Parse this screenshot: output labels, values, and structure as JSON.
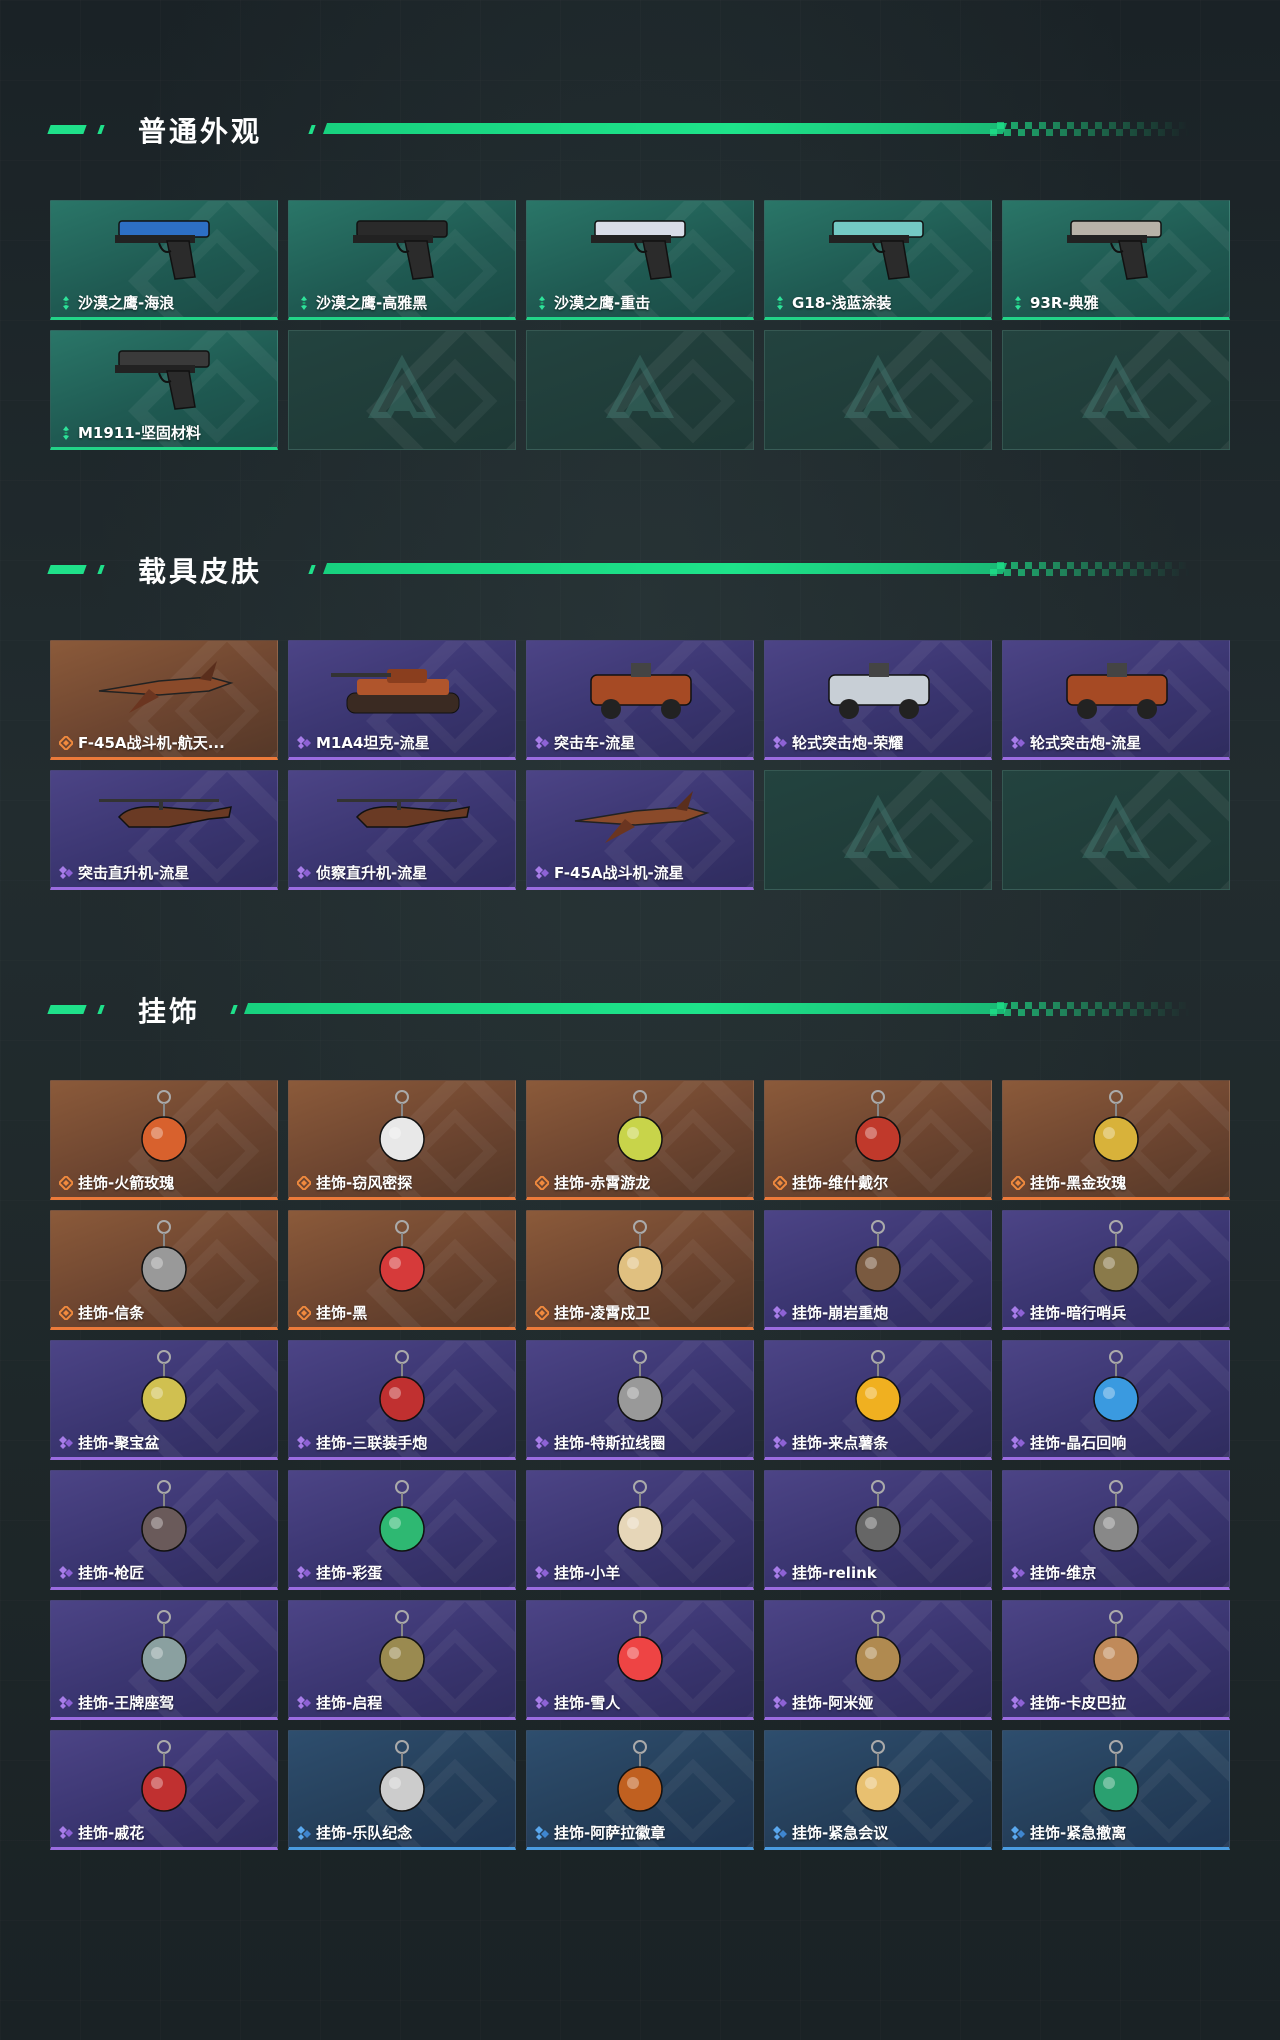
{
  "colors": {
    "accent": "#1ee38a",
    "green_card": "#1f5a52",
    "purple_card": "#3a3570",
    "orange_card": "#6d4530",
    "blue_card": "#253f5a"
  },
  "sections": [
    {
      "title": "普通外观",
      "items": [
        {
          "label": "沙漠之鹰-海浪",
          "rarity": "green",
          "icon": "pistol-icon"
        },
        {
          "label": "沙漠之鹰-高雅黑",
          "rarity": "green",
          "icon": "pistol-icon"
        },
        {
          "label": "沙漠之鹰-重击",
          "rarity": "green",
          "icon": "pistol-icon"
        },
        {
          "label": "G18-浅蓝涂装",
          "rarity": "green",
          "icon": "pistol-icon"
        },
        {
          "label": "93R-典雅",
          "rarity": "green",
          "icon": "pistol-icon"
        },
        {
          "label": "M1911-坚固材料",
          "rarity": "green",
          "icon": "pistol-icon"
        },
        {
          "label": "",
          "rarity": "empty",
          "icon": "empty-slot-logo-icon"
        },
        {
          "label": "",
          "rarity": "empty",
          "icon": "empty-slot-logo-icon"
        },
        {
          "label": "",
          "rarity": "empty",
          "icon": "empty-slot-logo-icon"
        },
        {
          "label": "",
          "rarity": "empty",
          "icon": "empty-slot-logo-icon"
        }
      ]
    },
    {
      "title": "载具皮肤",
      "items": [
        {
          "label": "F-45A战斗机-航天...",
          "rarity": "orange",
          "icon": "jet-icon"
        },
        {
          "label": "M1A4坦克-流星",
          "rarity": "purple",
          "icon": "tank-icon"
        },
        {
          "label": "突击车-流星",
          "rarity": "purple",
          "icon": "truck-icon"
        },
        {
          "label": "轮式突击炮-荣耀",
          "rarity": "purple",
          "icon": "armored-car-icon"
        },
        {
          "label": "轮式突击炮-流星",
          "rarity": "purple",
          "icon": "armored-car-icon"
        },
        {
          "label": "突击直升机-流星",
          "rarity": "purple",
          "icon": "helicopter-icon"
        },
        {
          "label": "侦察直升机-流星",
          "rarity": "purple",
          "icon": "helicopter-icon"
        },
        {
          "label": "F-45A战斗机-流星",
          "rarity": "purple",
          "icon": "jet-icon"
        },
        {
          "label": "",
          "rarity": "empty",
          "icon": "empty-slot-logo-icon"
        },
        {
          "label": "",
          "rarity": "empty",
          "icon": "empty-slot-logo-icon"
        }
      ]
    },
    {
      "title": "挂饰",
      "items": [
        {
          "label": "挂饰-火箭玫瑰",
          "rarity": "orange",
          "icon": "charm-icon"
        },
        {
          "label": "挂饰-窃风密探",
          "rarity": "orange",
          "icon": "charm-icon"
        },
        {
          "label": "挂饰-赤霄游龙",
          "rarity": "orange",
          "icon": "charm-icon"
        },
        {
          "label": "挂饰-维什戴尔",
          "rarity": "orange",
          "icon": "charm-icon"
        },
        {
          "label": "挂饰-黑金玫瑰",
          "rarity": "orange",
          "icon": "charm-icon"
        },
        {
          "label": "挂饰-信条",
          "rarity": "orange",
          "icon": "charm-icon"
        },
        {
          "label": "挂饰-黑",
          "rarity": "orange",
          "icon": "charm-icon"
        },
        {
          "label": "挂饰-凌霄戍卫",
          "rarity": "orange",
          "icon": "charm-icon"
        },
        {
          "label": "挂饰-崩岩重炮",
          "rarity": "purple",
          "icon": "charm-icon"
        },
        {
          "label": "挂饰-暗行哨兵",
          "rarity": "purple",
          "icon": "charm-icon"
        },
        {
          "label": "挂饰-聚宝盆",
          "rarity": "purple",
          "icon": "charm-icon"
        },
        {
          "label": "挂饰-三联装手炮",
          "rarity": "purple",
          "icon": "charm-icon"
        },
        {
          "label": "挂饰-特斯拉线圈",
          "rarity": "purple",
          "icon": "charm-icon"
        },
        {
          "label": "挂饰-来点薯条",
          "rarity": "purple",
          "icon": "charm-icon"
        },
        {
          "label": "挂饰-晶石回响",
          "rarity": "purple",
          "icon": "charm-icon"
        },
        {
          "label": "挂饰-枪匠",
          "rarity": "purple",
          "icon": "charm-icon"
        },
        {
          "label": "挂饰-彩蛋",
          "rarity": "purple",
          "icon": "charm-icon"
        },
        {
          "label": "挂饰-小羊",
          "rarity": "purple",
          "icon": "charm-icon"
        },
        {
          "label": "挂饰-relink",
          "rarity": "purple",
          "icon": "charm-icon"
        },
        {
          "label": "挂饰-维京",
          "rarity": "purple",
          "icon": "charm-icon"
        },
        {
          "label": "挂饰-王牌座驾",
          "rarity": "purple",
          "icon": "charm-icon"
        },
        {
          "label": "挂饰-启程",
          "rarity": "purple",
          "icon": "charm-icon"
        },
        {
          "label": "挂饰-雪人",
          "rarity": "purple",
          "icon": "charm-icon"
        },
        {
          "label": "挂饰-阿米娅",
          "rarity": "purple",
          "icon": "charm-icon"
        },
        {
          "label": "挂饰-卡皮巴拉",
          "rarity": "purple",
          "icon": "charm-icon"
        },
        {
          "label": "挂饰-戚花",
          "rarity": "purple",
          "icon": "charm-icon"
        },
        {
          "label": "挂饰-乐队纪念",
          "rarity": "blue",
          "icon": "charm-icon"
        },
        {
          "label": "挂饰-阿萨拉徽章",
          "rarity": "blue",
          "icon": "charm-icon"
        },
        {
          "label": "挂饰-紧急会议",
          "rarity": "blue",
          "icon": "charm-icon"
        },
        {
          "label": "挂饰-紧急撤离",
          "rarity": "blue",
          "icon": "charm-icon"
        }
      ]
    }
  ]
}
